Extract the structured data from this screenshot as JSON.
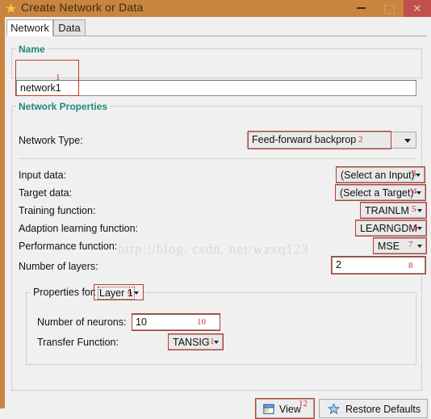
{
  "window": {
    "title": "Create Network or Data",
    "app_icon": "star-icon",
    "minimize_label": "–",
    "maximize_label": "□",
    "close_label": "✕",
    "titlebar_color": "#c9843f",
    "close_color": "#c0504d"
  },
  "tabs": [
    {
      "label": "Network",
      "active": true
    },
    {
      "label": "Data",
      "active": false
    }
  ],
  "name_group": {
    "title": "Name",
    "value": "network1",
    "annotation": "1"
  },
  "network_properties": {
    "title": "Network Properties",
    "rows": [
      {
        "label": "Network Type:",
        "value": "Feed-forward backprop",
        "annotation": "2",
        "control": "combo"
      },
      {
        "label": "Input data:",
        "value": "(Select an Input)",
        "annotation": "3",
        "control": "combo"
      },
      {
        "label": "Target data:",
        "value": "(Select a Target)",
        "annotation": "4",
        "control": "combo"
      },
      {
        "label": "Training function:",
        "value": "TRAINLM",
        "annotation": "5",
        "control": "combo"
      },
      {
        "label": "Adaption learning function:",
        "value": "LEARNGDM",
        "annotation": "6",
        "control": "combo"
      },
      {
        "label": "Performance function:",
        "value": "MSE",
        "annotation": "7",
        "control": "combo"
      },
      {
        "label": "Number of layers:",
        "value": "2",
        "annotation": "8",
        "control": "textbox"
      }
    ]
  },
  "properties_for": {
    "title": "Properties for:",
    "layer_value": "Layer 1",
    "layer_annotation": "9",
    "rows": [
      {
        "label": "Number of neurons:",
        "value": "10",
        "annotation": "10",
        "control": "textbox"
      },
      {
        "label": "Transfer Function:",
        "value": "TANSIG",
        "annotation": "11",
        "control": "combo"
      }
    ]
  },
  "footer": {
    "view_button": {
      "label": "View",
      "icon": "window-icon",
      "annotation": "12"
    },
    "restore_button": {
      "label": "Restore Defaults",
      "icon": "star-icon"
    }
  },
  "watermark": {
    "text": "http://blog. csdn. net/wzxq123"
  },
  "colors": {
    "group_title": "#1f8a7a",
    "annotation": "#c0392b",
    "face": "#f0f0f0"
  }
}
